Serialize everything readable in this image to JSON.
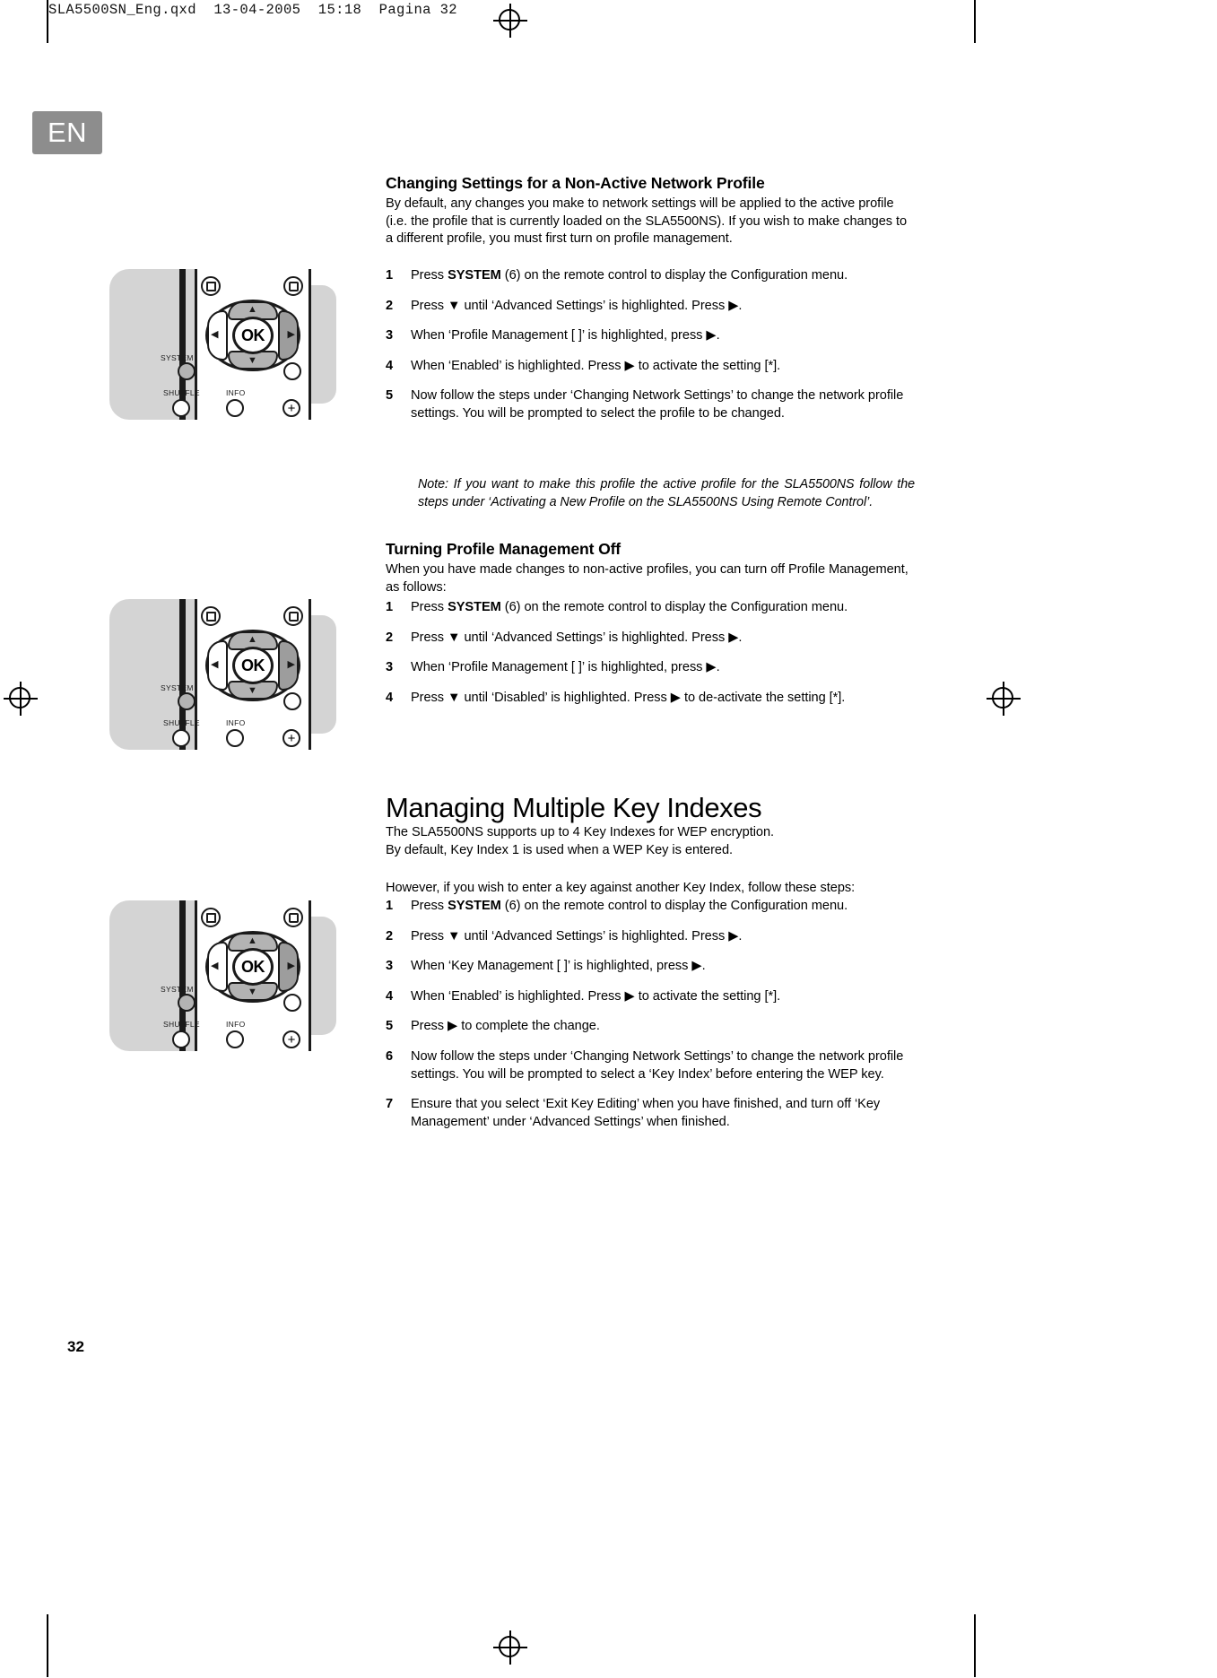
{
  "print_header": "SLA5500SN_Eng.qxd  13-04-2005  15:18  Pagina 32",
  "language_badge": "EN",
  "folio": "32",
  "remote": {
    "ok_label": "OK",
    "labels": {
      "system": "SYSTEM",
      "shuffle": "SHUFFLE",
      "info": "INFO"
    },
    "up_arrow": "▲",
    "down_arrow": "▼",
    "left_arrow": "◀",
    "right_arrow": "▶",
    "plus": "+"
  },
  "sections": [
    {
      "heading": "Changing Settings for a Non-Active Network Profile",
      "intro": "By default, any changes you make to network settings will be applied to the active profile (i.e. the profile that is currently loaded on the SLA5500NS). If you wish to make changes to a different profile, you must first turn on profile management.",
      "steps": [
        {
          "n": "1",
          "pre": "Press ",
          "kw": "SYSTEM",
          "post": " (6) on the remote control to display the Configuration menu."
        },
        {
          "n": "2",
          "text": "Press ▼ until ‘Advanced Settings’ is highlighted. Press ▶."
        },
        {
          "n": "3",
          "text": "When ‘Profile Management [ ]’ is highlighted, press ▶."
        },
        {
          "n": "4",
          "text": "When ‘Enabled’ is highlighted. Press ▶ to activate the setting [*]."
        },
        {
          "n": "5",
          "text": "Now follow the steps under ‘Changing Network Settings’ to change the network profile settings. You will be prompted to select the profile to be changed."
        }
      ],
      "note": "Note: If you want to make this profile the active profile for the SLA5500NS follow the steps under ‘Activating a New Profile on the SLA5500NS Using Remote Control’."
    },
    {
      "heading": "Turning Profile Management Off",
      "intro": "When you have made changes to non-active profiles, you can turn off Profile Management, as follows:",
      "steps": [
        {
          "n": "1",
          "pre": "Press ",
          "kw": "SYSTEM",
          "post": " (6) on the remote control to display the Configuration menu."
        },
        {
          "n": "2",
          "text": "Press ▼ until ‘Advanced Settings’ is highlighted. Press ▶."
        },
        {
          "n": "3",
          "text": "When ‘Profile Management [ ]’ is highlighted, press ▶."
        },
        {
          "n": "4",
          "text": "Press ▼ until ‘Disabled’ is highlighted. Press ▶ to de-activate the setting [*]."
        }
      ]
    },
    {
      "title": "Managing Multiple Key Indexes",
      "intro_line1": "The SLA5500NS supports up to 4 Key Indexes for WEP encryption.",
      "intro_line2": "By default, Key Index 1 is used when a WEP Key is entered.",
      "intro_line3": "However, if you wish to enter a key against another Key Index, follow these steps:",
      "steps": [
        {
          "n": "1",
          "pre": "Press ",
          "kw": "SYSTEM",
          "post": " (6) on the remote control to display the Configuration menu."
        },
        {
          "n": "2",
          "text": "Press ▼ until ‘Advanced Settings’ is highlighted. Press ▶."
        },
        {
          "n": "3",
          "text": "When ‘Key Management [ ]’ is highlighted, press ▶."
        },
        {
          "n": "4",
          "text": "When ‘Enabled’ is highlighted. Press ▶ to activate the setting [*]."
        },
        {
          "n": "5",
          "text": "Press ▶ to complete the change."
        },
        {
          "n": "6",
          "text": "Now follow the steps under ‘Changing Network Settings’ to change the network profile settings. You will be prompted to select a ‘Key Index’ before entering the WEP key."
        },
        {
          "n": "7",
          "text": "Ensure that you select ‘Exit Key Editing’ when you have finished, and turn off ‘Key Management’ under ‘Advanced Settings’ when finished."
        }
      ]
    }
  ]
}
